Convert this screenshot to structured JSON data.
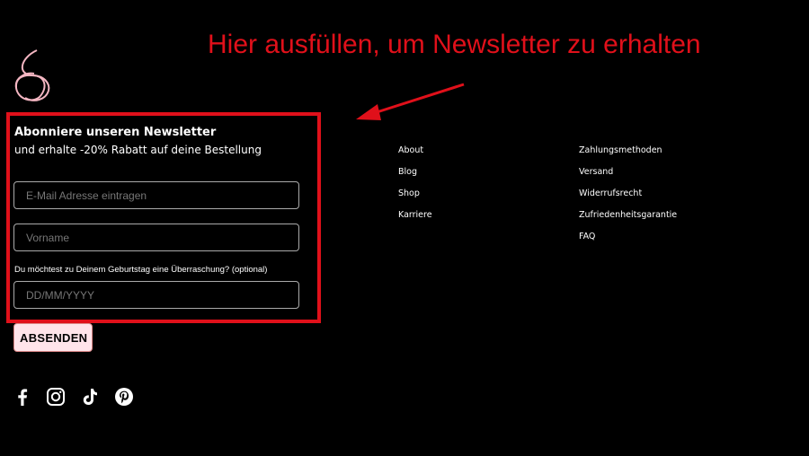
{
  "annotation": {
    "text": "Hier ausfüllen, um Newsletter zu erhalten"
  },
  "newsletter": {
    "title": "Abonniere unseren Newsletter",
    "subtitle": "und erhalte -20% Rabatt auf deine Bestellung",
    "email_placeholder": "E-Mail Adresse eintragen",
    "name_placeholder": "Vorname",
    "birthday_label": "Du möchtest zu Deinem Geburtstag eine Überraschung? (optional)",
    "birthday_placeholder": "DD/MM/YYYY",
    "submit_label": "ABSENDEN"
  },
  "footer": {
    "col1": [
      "About",
      "Blog",
      "Shop",
      "Karriere"
    ],
    "col2": [
      "Zahlungsmethoden",
      "Versand",
      "Widerrufsrecht",
      "Zufriedenheitsgarantie",
      "FAQ"
    ]
  },
  "social": [
    "facebook-icon",
    "instagram-icon",
    "tiktok-icon",
    "pinterest-icon"
  ],
  "colors": {
    "annotation": "#e0101a",
    "button_bg": "#ffe4ea",
    "logo": "#f4b6c2"
  }
}
